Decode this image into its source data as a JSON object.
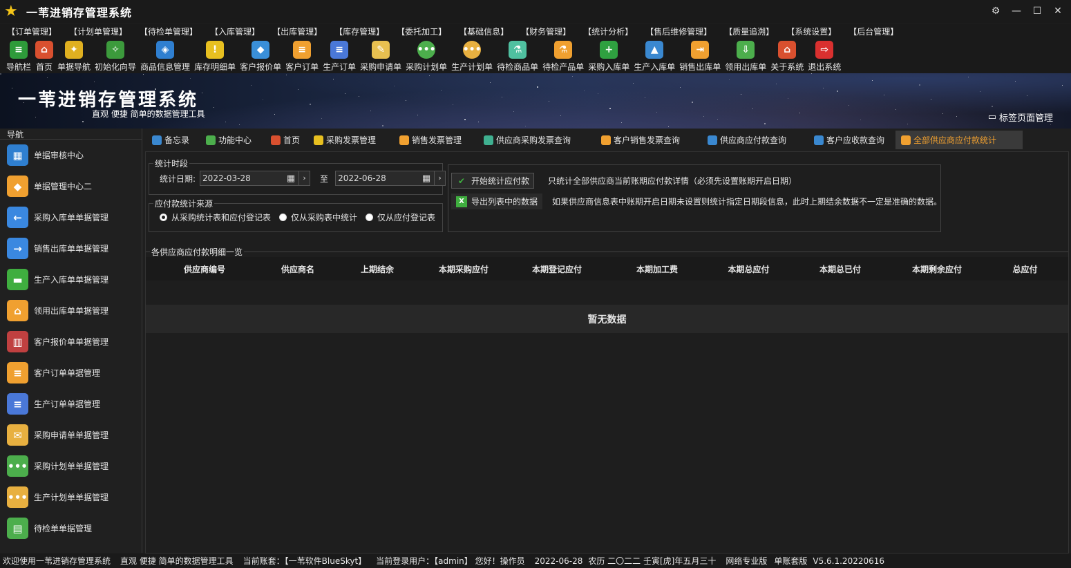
{
  "app": {
    "title": "一苇进销存管理系统"
  },
  "menu": [
    "【订单管理】",
    "【计划单管理】",
    "【待检单管理】",
    "【入库管理】",
    "【出库管理】",
    "【库存管理】",
    "【委托加工】",
    "【基础信息】",
    "【财务管理】",
    "【统计分析】",
    "【售后维修管理】",
    "【质量追溯】",
    "【系统设置】",
    "【后台管理】"
  ],
  "toolbar": [
    {
      "label": "导航栏",
      "icon": "menu-icon",
      "color": "#2e9b3a"
    },
    {
      "label": "首页",
      "icon": "home-icon",
      "color": "#d9502f"
    },
    {
      "label": "单据导航",
      "icon": "lamp-icon",
      "color": "#e0b020"
    },
    {
      "label": "初始化向导",
      "icon": "wand-icon",
      "color": "#3c9a3c"
    },
    {
      "label": "商品信息管理",
      "icon": "cubes-icon",
      "color": "#2f7fd0"
    },
    {
      "label": "库存明细单",
      "icon": "warning-icon",
      "color": "#e8c020"
    },
    {
      "label": "客户报价单",
      "icon": "tag-icon",
      "color": "#3a8fd8"
    },
    {
      "label": "客户订单",
      "icon": "doc-icon",
      "color": "#f0a030"
    },
    {
      "label": "生产订单",
      "icon": "doc-icon",
      "color": "#4a78d8"
    },
    {
      "label": "采购申请单",
      "icon": "note-icon",
      "color": "#e8c050"
    },
    {
      "label": "采购计划单",
      "icon": "chat-icon",
      "color": "#4cae4c"
    },
    {
      "label": "生产计划单",
      "icon": "chat-icon",
      "color": "#e8b040"
    },
    {
      "label": "待检商品单",
      "icon": "flask-icon",
      "color": "#4fc0a0"
    },
    {
      "label": "待检产品单",
      "icon": "beaker-icon",
      "color": "#f0a030"
    },
    {
      "label": "采购入库单",
      "icon": "plus-icon",
      "color": "#2fa040"
    },
    {
      "label": "生产入库单",
      "icon": "cart-icon",
      "color": "#3a88d0"
    },
    {
      "label": "销售出库单",
      "icon": "export-icon",
      "color": "#f0a030"
    },
    {
      "label": "领用出库单",
      "icon": "download-icon",
      "color": "#4cae4c"
    },
    {
      "label": "关于系统",
      "icon": "house-icon",
      "color": "#d9502f"
    },
    {
      "label": "退出系统",
      "icon": "exit-icon",
      "color": "#d9302f"
    }
  ],
  "banner": {
    "title": "一苇进销存管理系统",
    "subtitle": "直观 便捷 简单的数据管理工具",
    "tab_manage": "标签页面管理"
  },
  "sidebar": {
    "header": "导航",
    "items": [
      {
        "label": "单据审核中心",
        "color": "#2f7fd0",
        "glyph": "▦"
      },
      {
        "label": "单据管理中心二",
        "color": "#f0a030",
        "glyph": "◆"
      },
      {
        "label": "采购入库单单据管理",
        "color": "#3a88e0",
        "glyph": "←"
      },
      {
        "label": "销售出库单单据管理",
        "color": "#3a88e0",
        "glyph": "→"
      },
      {
        "label": "生产入库单单据管理",
        "color": "#3fae3f",
        "glyph": "▬"
      },
      {
        "label": "领用出库单单据管理",
        "color": "#f0a030",
        "glyph": "⌂"
      },
      {
        "label": "客户报价单单据管理",
        "color": "#c04040",
        "glyph": "▥"
      },
      {
        "label": "客户订单单据管理",
        "color": "#f0a030",
        "glyph": "≡"
      },
      {
        "label": "生产订单单据管理",
        "color": "#4a78d8",
        "glyph": "≡"
      },
      {
        "label": "采购申请单单据管理",
        "color": "#e8b040",
        "glyph": "✉"
      },
      {
        "label": "采购计划单单据管理",
        "color": "#4cae4c",
        "glyph": "•••"
      },
      {
        "label": "生产计划单单据管理",
        "color": "#e8b040",
        "glyph": "•••"
      },
      {
        "label": "待检单单据管理",
        "color": "#4cae4c",
        "glyph": "▤"
      }
    ]
  },
  "tabs": [
    {
      "label": "备忘录",
      "color": "#3a88d0"
    },
    {
      "label": "功能中心",
      "color": "#4cae4c"
    },
    {
      "label": "首页",
      "color": "#d9502f"
    },
    {
      "label": "采购发票管理",
      "color": "#e8c020"
    },
    {
      "label": "销售发票管理",
      "color": "#f0a030"
    },
    {
      "label": "供应商采购发票查询",
      "color": "#3fb090"
    },
    {
      "label": "客户销售发票查询",
      "color": "#f0a030"
    },
    {
      "label": "供应商应付款查询",
      "color": "#3a88d0"
    },
    {
      "label": "客户应收款查询",
      "color": "#3a88d0"
    },
    {
      "label": "全部供应商应付款统计",
      "color": "#f0a030"
    }
  ],
  "stats": {
    "period_legend": "统计时段",
    "date_label": "统计日期:",
    "date_from": "2022-03-28",
    "to_label": "至",
    "date_to": "2022-06-28",
    "source_legend": "应付款统计来源",
    "sources": [
      "从采购统计表和应付登记表",
      "仅从采购表中统计",
      "仅从应付登记表"
    ],
    "start_button": "开始统计应付款",
    "export_button": "导出列表中的数据",
    "note1": "只统计全部供应商当前账期应付款详情（必须先设置账期开启日期）",
    "note2": "如果供应商信息表中账期开启日期未设置则统计指定日期段信息，此时上期结余数据不一定是准确的数据。"
  },
  "grid": {
    "legend": "各供应商应付款明细一览",
    "columns": [
      "供应商编号",
      "供应商名",
      "上期结余",
      "本期采购应付",
      "本期登记应付",
      "本期加工费",
      "本期总应付",
      "本期总已付",
      "本期剩余应付",
      "总应付"
    ],
    "empty_text": "暂无数据"
  },
  "status": {
    "welcome": "欢迎使用一苇进销存管理系统",
    "slogan": "直观 便捷 简单的数据管理工具",
    "account": "当前账套：【一苇软件BlueSkyt】",
    "user": "当前登录用户：【admin】 您好！操作员",
    "date": "2022-06-28",
    "lunar": "农历 二〇二二 壬寅[虎]年五月三十",
    "edition": "网络专业版",
    "mode": "单账套版",
    "version": "V5.6.1.20220616"
  }
}
